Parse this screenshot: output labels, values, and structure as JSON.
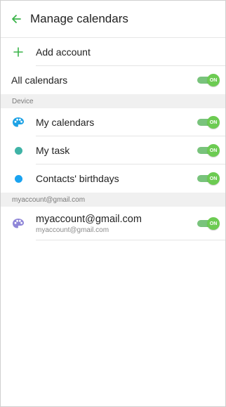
{
  "header": {
    "title": "Manage calendars"
  },
  "add_account": {
    "label": "Add account"
  },
  "all_calendars": {
    "label": "All calendars",
    "toggle": "ON"
  },
  "sections": {
    "device": {
      "header": "Device",
      "items": [
        {
          "label": "My calendars",
          "toggle": "ON",
          "icon": "palette-icon",
          "color": "#1ea2e5"
        },
        {
          "label": "My task",
          "toggle": "ON",
          "icon": "dot-icon",
          "color": "#3fb3a6"
        },
        {
          "label": "Contacts' birthdays",
          "toggle": "ON",
          "icon": "dot-icon",
          "color": "#1aa3f0"
        }
      ]
    },
    "account": {
      "header": "myaccount@gmail.com",
      "items": [
        {
          "label": "myaccount@gmail.com",
          "sublabel": "myaccount@gmail.com",
          "toggle": "ON",
          "icon": "palette-icon",
          "color": "#8f86d8"
        }
      ]
    }
  },
  "colors": {
    "accent": "#4caf50",
    "toggle_on": "#6ccb52",
    "section_bg": "#f0f0f0"
  }
}
